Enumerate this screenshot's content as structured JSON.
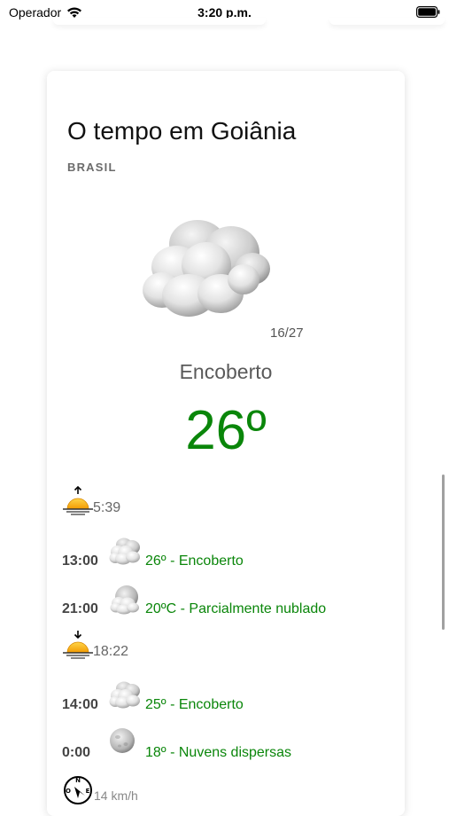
{
  "status_bar": {
    "carrier": "Operador",
    "time": "3:20 p.m."
  },
  "weather": {
    "title": "O tempo em Goiânia",
    "country": "BRASIL",
    "minmax": "16/27",
    "condition": "Encoberto",
    "temperature": "26º",
    "main_icon": "overcast-cloud-icon"
  },
  "sunrise": {
    "time": "5:39",
    "icon": "sunrise-icon"
  },
  "sunset": {
    "time": "18:22",
    "icon": "sunset-icon"
  },
  "forecast": [
    {
      "hour": "13:00",
      "text": "26º - Encoberto",
      "icon": "overcast-cloud-icon"
    },
    {
      "hour": "21:00",
      "text": "20ºC - Parcialmente nublado",
      "icon": "partly-cloudy-night-icon"
    },
    {
      "hour": "14:00",
      "text": "25º - Encoberto",
      "icon": "overcast-cloud-icon"
    },
    {
      "hour": "0:00",
      "text": "18º - Nuvens dispersas",
      "icon": "scattered-clouds-icon"
    }
  ],
  "wind": {
    "icon": "compass-icon",
    "text": "14 km/h"
  },
  "colors": {
    "temperature": "#0a860a",
    "forecast_text": "#0a860a",
    "sun": "#f4b400"
  }
}
